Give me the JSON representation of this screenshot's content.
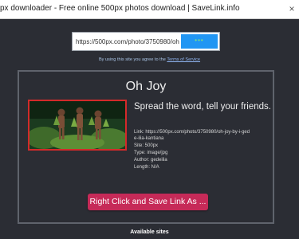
{
  "tab": {
    "title": "px downloader - Free online 500px photos download | SaveLink.info",
    "close_glyph": "×"
  },
  "form": {
    "url_value": "https://500px.com/photo/3750980/oh-",
    "submit_glyph": "•••"
  },
  "terms": {
    "prefix": "By using this site you agree to the ",
    "link": "Terms of Service"
  },
  "result": {
    "title": "Oh Joy",
    "tagline": "Spread the word, tell your friends.",
    "link_line1": "Link: https://500px.com/photo/3750980/oh-joy-by-i-ged",
    "link_line2": "e-ilia-kantiana",
    "site": "Site: 500px",
    "type": "Type: image/jpg",
    "author": "Author: gedeilia",
    "length": "Length: N/A",
    "save_label": "Right Click and Save Link As ..."
  },
  "footer": {
    "heading": "Available sites"
  },
  "colors": {
    "background": "#2b2d34",
    "thumb_border": "#d32a2a",
    "save_button": "#c62a58",
    "submit_button": "#2196f3"
  }
}
